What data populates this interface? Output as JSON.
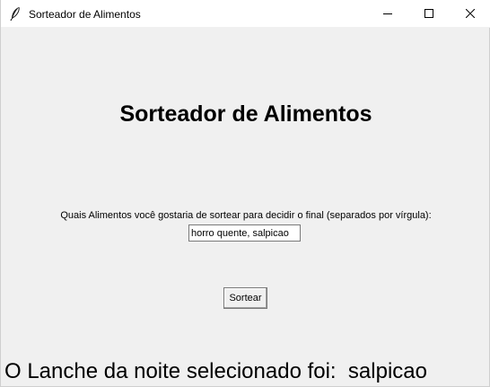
{
  "window": {
    "title": "Sorteador de Alimentos",
    "controls": {
      "minimize_icon": "minimize-icon",
      "maximize_icon": "maximize-icon",
      "close_icon": "close-icon"
    },
    "app_icon": "feather-icon"
  },
  "main": {
    "heading": "Sorteador de Alimentos",
    "prompt": "Quais Alimentos você gostaria de sortear para decidir o final (separados por vírgula):",
    "input_value": "horro quente, salpicao",
    "button_label": "Sortear",
    "result_text": "O Lanche da noite selecionado foi:  salpicao"
  },
  "colors": {
    "background": "#f0f0f0",
    "titlebar": "#ffffff",
    "text": "#000000"
  }
}
